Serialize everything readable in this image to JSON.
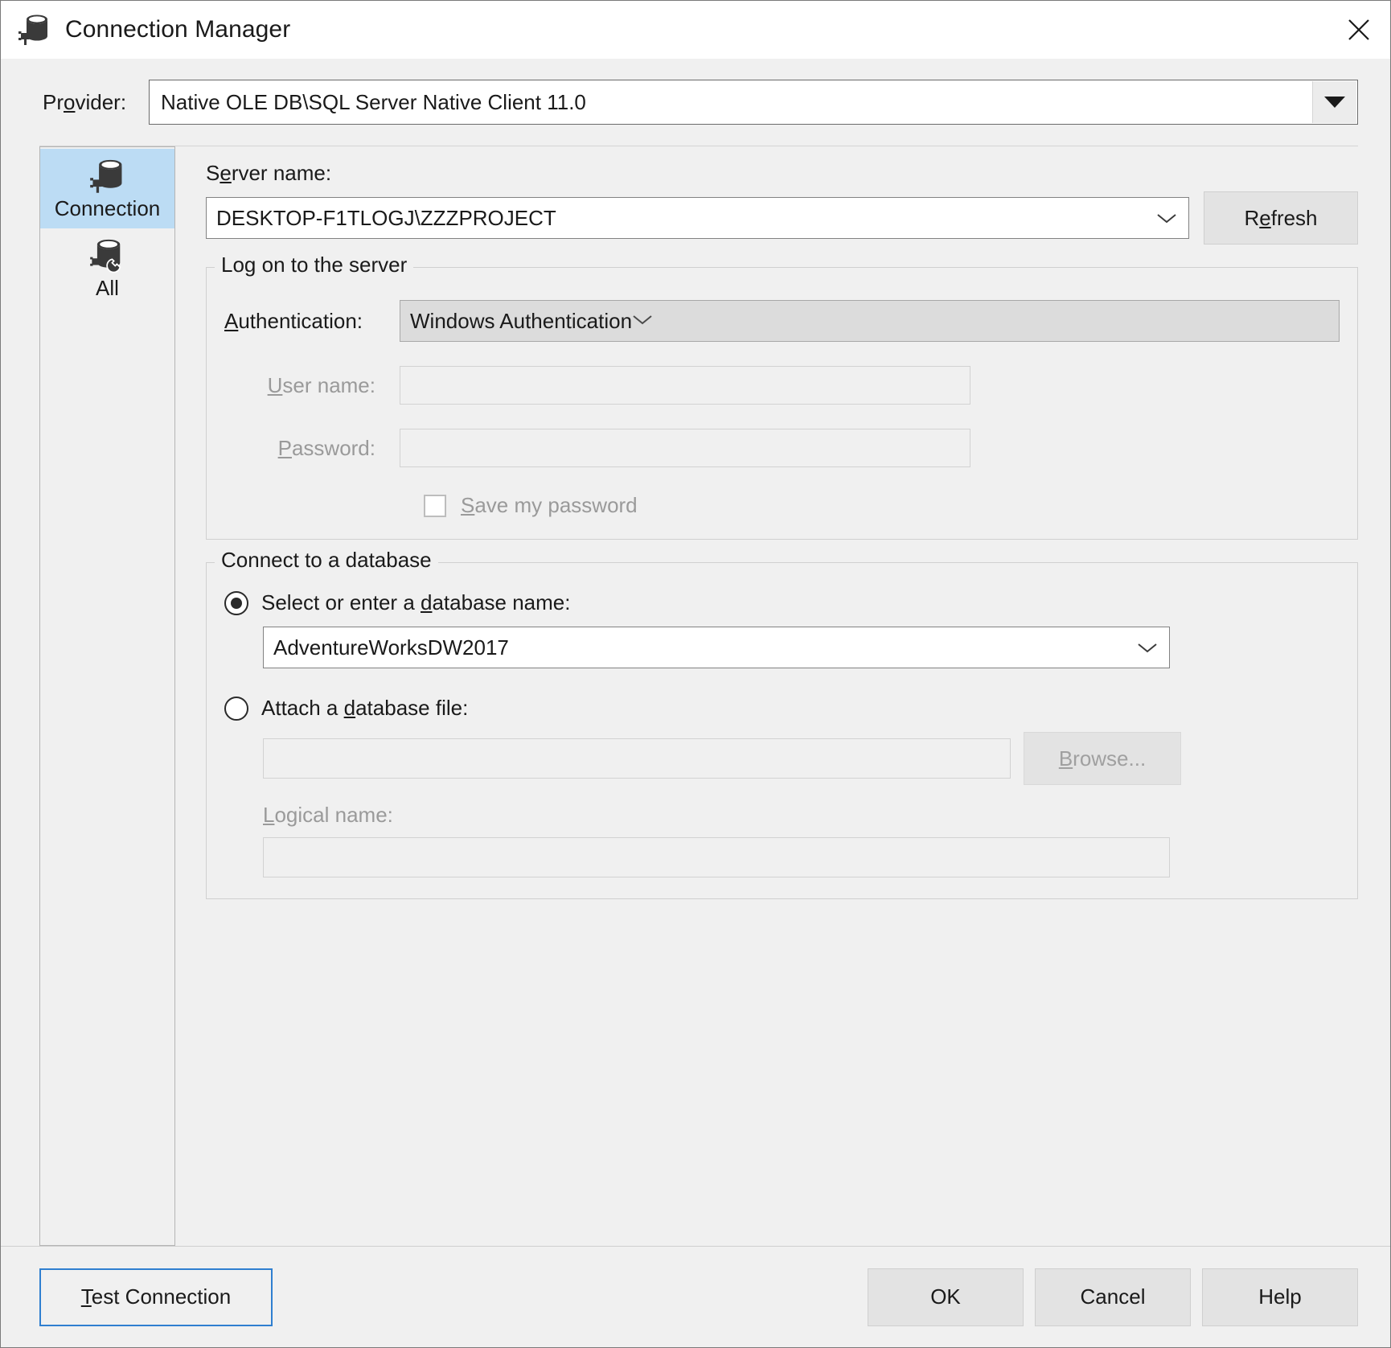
{
  "window": {
    "title": "Connection Manager",
    "icon": "database-plug-icon",
    "close_label": "Close"
  },
  "provider": {
    "label": "Provider:",
    "label_accel": "o",
    "value": "Native OLE DB\\SQL Server Native Client 11.0"
  },
  "tabs": [
    {
      "label": "Connection",
      "icon": "database-plug-icon",
      "selected": true
    },
    {
      "label": "All",
      "icon": "database-wrench-icon",
      "selected": false
    }
  ],
  "connection": {
    "server_name": {
      "label_pre": "S",
      "label_accel": "e",
      "label_post": "rver name:",
      "value": "DESKTOP-F1TLOGJ\\ZZZPROJECT"
    },
    "refresh_button": {
      "label_pre": "R",
      "label_accel": "e",
      "label_post": "fresh"
    },
    "logon_group": {
      "legend": "Log on to the server",
      "authentication": {
        "label_accel": "A",
        "label_post": "uthentication:",
        "value": "Windows Authentication"
      },
      "user_name": {
        "label_accel": "U",
        "label_post": "ser name:",
        "value": "",
        "enabled": false
      },
      "password": {
        "label_accel": "P",
        "label_post": "assword:",
        "value": "",
        "enabled": false
      },
      "save_password": {
        "label_accel": "S",
        "label_post": "ave my password",
        "checked": false,
        "enabled": false
      }
    },
    "database_group": {
      "legend": "Connect to a database",
      "select_db": {
        "label_pre": "Select or enter a ",
        "label_accel": "d",
        "label_post": "atabase name:",
        "selected": true,
        "value": "AdventureWorksDW2017"
      },
      "attach_db": {
        "label_pre": "Attach a ",
        "label_accel": "d",
        "label_post": "atabase file:",
        "selected": false,
        "value": "",
        "browse_button": {
          "label_pre": "",
          "label_accel": "B",
          "label_post": "rowse..."
        },
        "logical_name": {
          "label_accel": "L",
          "label_post": "ogical name:",
          "value": ""
        }
      }
    }
  },
  "footer": {
    "test_connection": {
      "label_accel": "T",
      "label_post": "est Connection"
    },
    "ok": "OK",
    "cancel": "Cancel",
    "help": "Help"
  },
  "colors": {
    "dialog_bg": "#f0f0f0",
    "tab_selected": "#bcdcf4",
    "accent_border": "#2f7fd0",
    "text": "#1a1a1a",
    "text_disabled": "#9a9a9a"
  }
}
